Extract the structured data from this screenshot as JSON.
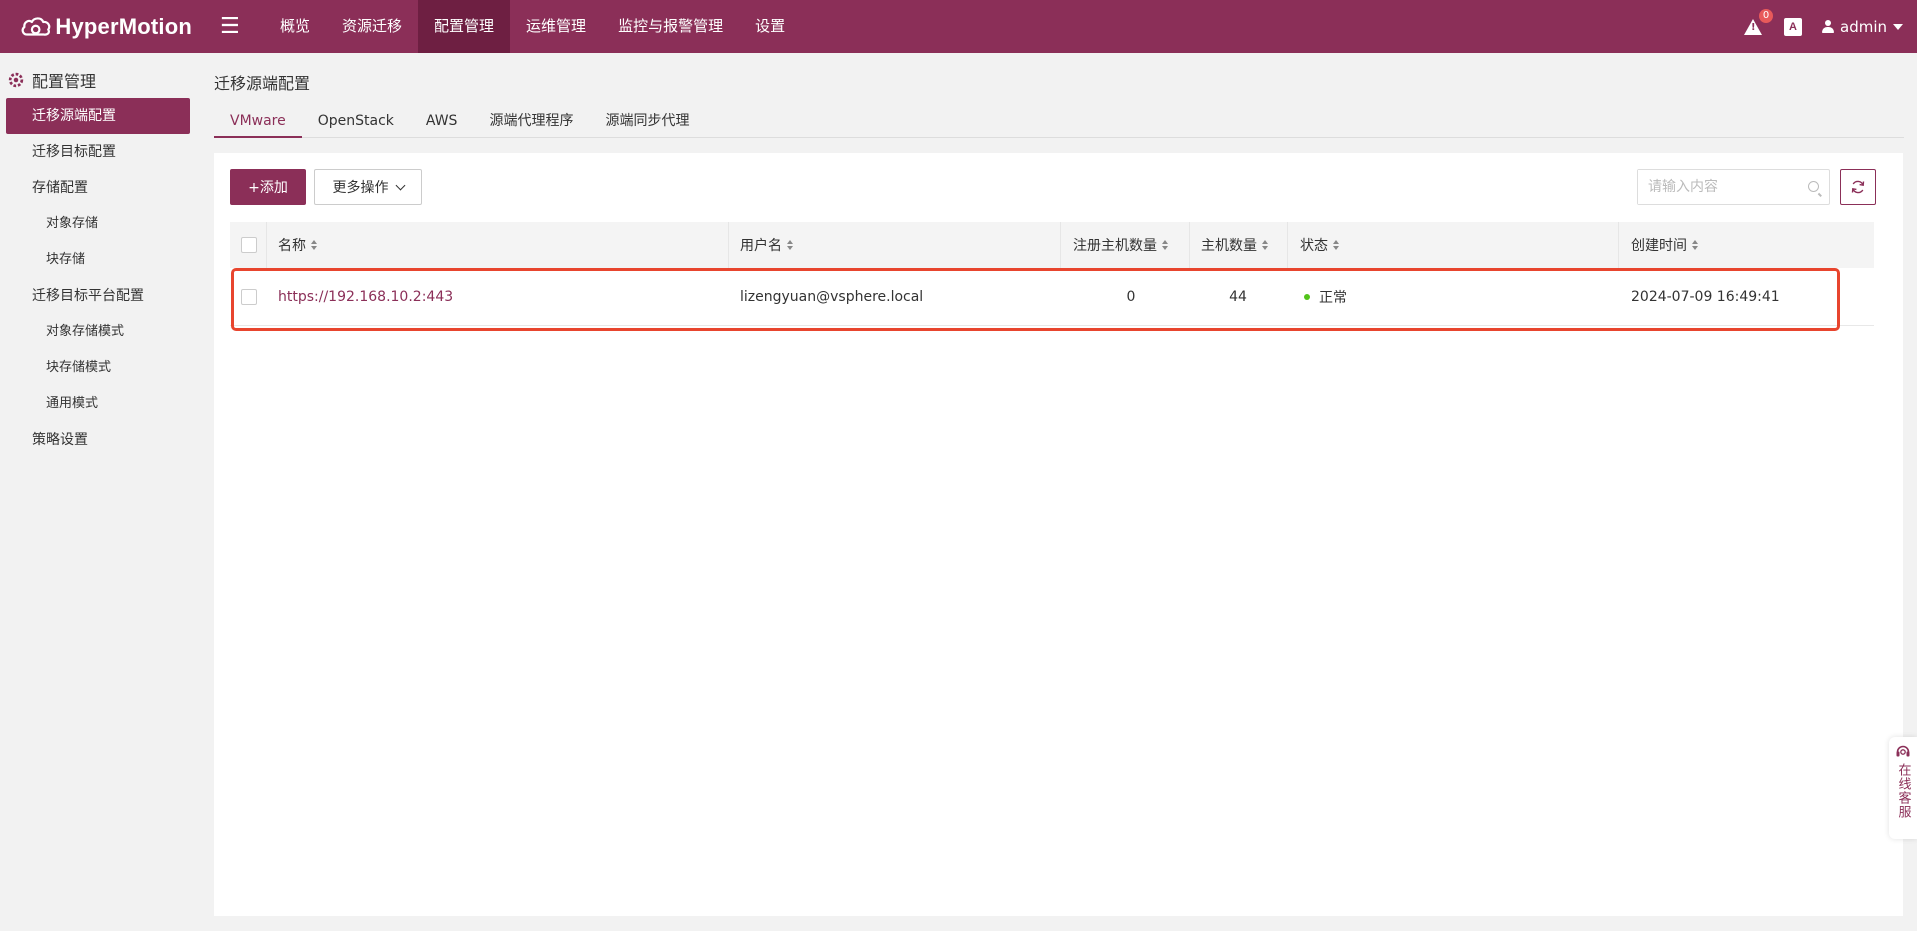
{
  "app": {
    "name": "HyperMotion"
  },
  "topnav": {
    "items": [
      {
        "label": "概览"
      },
      {
        "label": "资源迁移"
      },
      {
        "label": "配置管理",
        "active": true
      },
      {
        "label": "运维管理"
      },
      {
        "label": "监控与报警管理"
      },
      {
        "label": "设置"
      }
    ],
    "alert_count": "0",
    "lang_icon_text": "A",
    "user": "admin"
  },
  "sidebar": {
    "title": "配置管理",
    "items": [
      {
        "label": "迁移源端配置",
        "active": true
      },
      {
        "label": "迁移目标配置"
      },
      {
        "label": "存储配置"
      },
      {
        "label": "对象存储"
      },
      {
        "label": "块存储"
      },
      {
        "label": "迁移目标平台配置"
      },
      {
        "label": "对象存储模式"
      },
      {
        "label": "块存储模式"
      },
      {
        "label": "通用模式"
      },
      {
        "label": "策略设置"
      }
    ]
  },
  "main": {
    "title": "迁移源端配置",
    "tabs": [
      {
        "label": "VMware",
        "active": true
      },
      {
        "label": "OpenStack"
      },
      {
        "label": "AWS"
      },
      {
        "label": "源端代理程序"
      },
      {
        "label": "源端同步代理"
      }
    ],
    "toolbar": {
      "add_label": "+添加",
      "more_label": "更多操作",
      "search_placeholder": "请输入内容"
    },
    "table": {
      "columns": [
        "名称",
        "用户名",
        "注册主机数量",
        "主机数量",
        "状态",
        "创建时间"
      ],
      "rows": [
        {
          "name": "https://192.168.10.2:443",
          "username": "lizengyuan@vsphere.local",
          "registered_hosts": "0",
          "hosts": "44",
          "status": "正常",
          "created": "2024-07-09 16:49:41"
        }
      ]
    }
  },
  "service": {
    "label": "在线客服"
  },
  "colors": {
    "brand": "#8b2f58",
    "brand_dark": "#6e1f42",
    "status_ok": "#52c41a",
    "highlight": "#e8452e"
  }
}
